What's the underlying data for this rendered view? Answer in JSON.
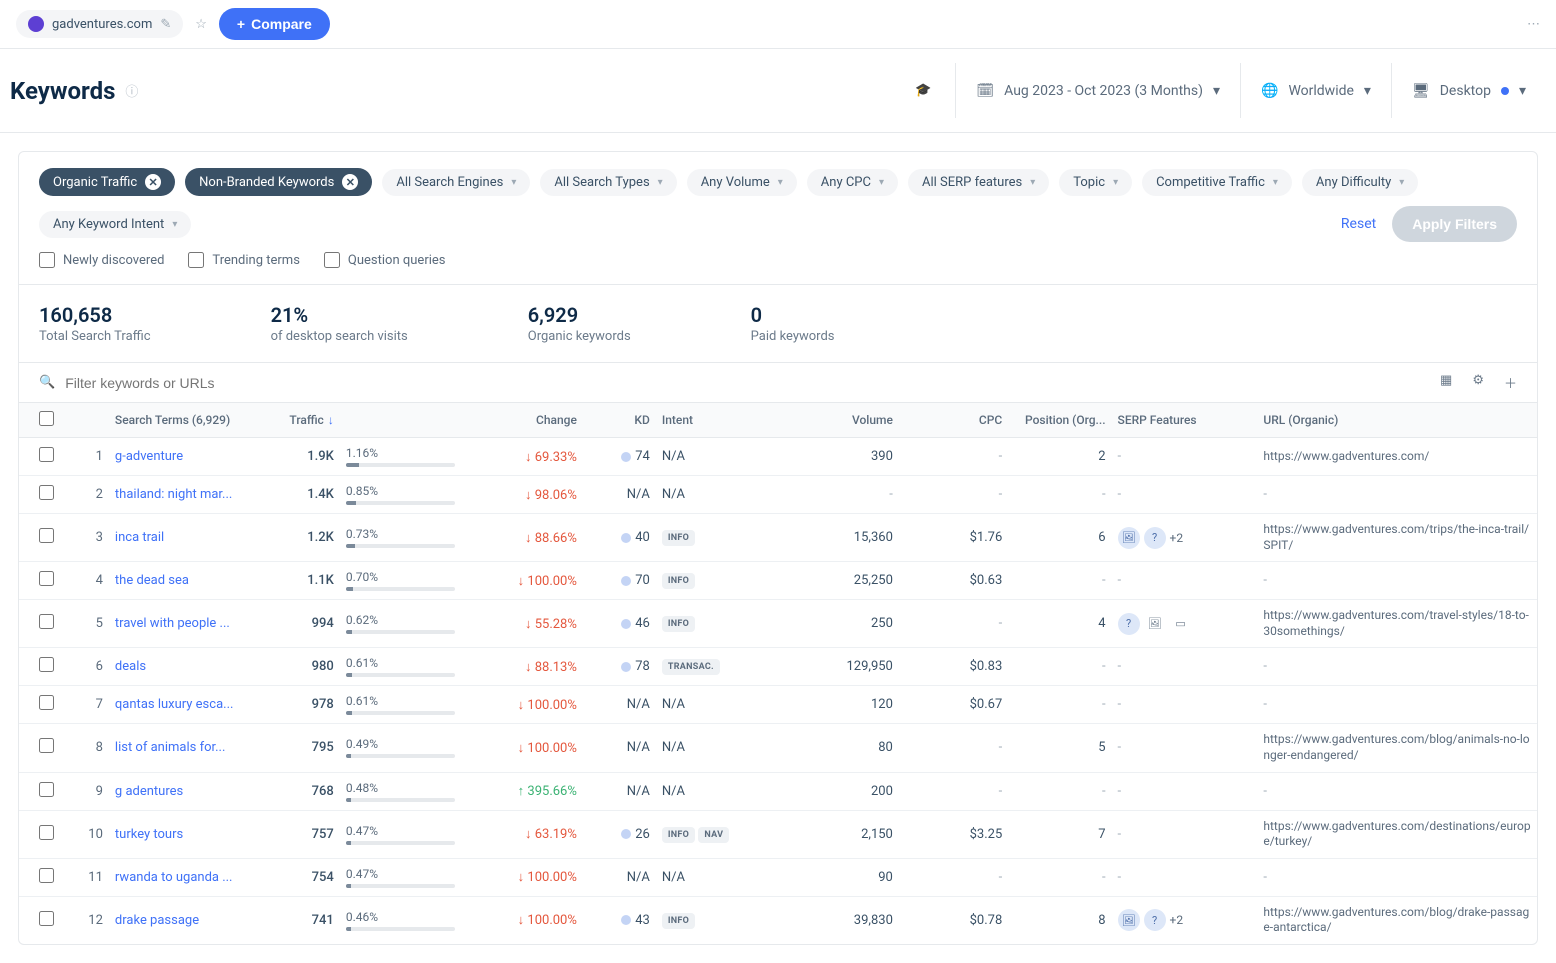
{
  "topbar": {
    "domain": "gadventures.com",
    "compare": "Compare"
  },
  "header": {
    "title": "Keywords",
    "date_filter": "Aug 2023 - Oct 2023 (3 Months)",
    "region": "Worldwide",
    "device": "Desktop"
  },
  "filters": {
    "active": [
      {
        "label": "Organic Traffic"
      },
      {
        "label": "Non-Branded Keywords"
      }
    ],
    "inactive": [
      "All Search Engines",
      "All Search Types",
      "Any Volume",
      "Any CPC",
      "All SERP features",
      "Topic",
      "Competitive Traffic",
      "Any Difficulty",
      "Any Keyword Intent"
    ],
    "checks": [
      "Newly discovered",
      "Trending terms",
      "Question queries"
    ],
    "reset": "Reset",
    "apply": "Apply Filters"
  },
  "stats": [
    {
      "big": "160,658",
      "small": "Total Search Traffic"
    },
    {
      "big": "21%",
      "small": "of desktop search visits"
    },
    {
      "big": "6,929",
      "small": "Organic keywords"
    },
    {
      "big": "0",
      "small": "Paid keywords"
    }
  ],
  "search": {
    "placeholder": "Filter keywords or URLs"
  },
  "table": {
    "headers": {
      "search_terms": "Search Terms (6,929)",
      "traffic": "Traffic",
      "change": "Change",
      "kd": "KD",
      "intent": "Intent",
      "volume": "Volume",
      "cpc": "CPC",
      "position": "Position (Org...",
      "serp": "SERP Features",
      "url": "URL (Organic)"
    },
    "rows": [
      {
        "n": "1",
        "term": "g-adventure",
        "traffic": "1.9K",
        "pct": "1.16%",
        "bar": 12,
        "change": "69.33%",
        "dir": "down",
        "kd": "74",
        "intent": [
          "N/A"
        ],
        "intentNA": true,
        "volume": "390",
        "cpc": "-",
        "pos": "2",
        "serp": "dash",
        "url": "https://www.gadventures.com/"
      },
      {
        "n": "2",
        "term": "thailand: night mar...",
        "traffic": "1.4K",
        "pct": "0.85%",
        "bar": 9,
        "change": "98.06%",
        "dir": "down",
        "kd": "N/A",
        "intent": [
          "N/A"
        ],
        "intentNA": true,
        "volume": "-",
        "cpc": "-",
        "pos": "-",
        "serp": "dash",
        "url": "-"
      },
      {
        "n": "3",
        "term": "inca trail",
        "traffic": "1.2K",
        "pct": "0.73%",
        "bar": 8,
        "change": "88.66%",
        "dir": "down",
        "kd": "40",
        "intent": [
          "INFO"
        ],
        "volume": "15,360",
        "cpc": "$1.76",
        "pos": "6",
        "serp": "img-q-2",
        "url": "https://www.gadventures.com/trips/the-inca-trail/SPIT/"
      },
      {
        "n": "4",
        "term": "the dead sea",
        "traffic": "1.1K",
        "pct": "0.70%",
        "bar": 7,
        "change": "100.00%",
        "dir": "down",
        "kd": "70",
        "intent": [
          "INFO"
        ],
        "volume": "25,250",
        "cpc": "$0.63",
        "pos": "-",
        "serp": "dash",
        "url": "-"
      },
      {
        "n": "5",
        "term": "travel with people ...",
        "traffic": "994",
        "pct": "0.62%",
        "bar": 6,
        "change": "55.28%",
        "dir": "down",
        "kd": "46",
        "intent": [
          "INFO"
        ],
        "volume": "250",
        "cpc": "-",
        "pos": "4",
        "serp": "q-img-plain",
        "url": "https://www.gadventures.com/travel-styles/18-to-30somethings/"
      },
      {
        "n": "6",
        "term": "deals",
        "traffic": "980",
        "pct": "0.61%",
        "bar": 6,
        "change": "88.13%",
        "dir": "down",
        "kd": "78",
        "intent": [
          "TRANSAC."
        ],
        "volume": "129,950",
        "cpc": "$0.83",
        "pos": "-",
        "serp": "dash",
        "url": "-"
      },
      {
        "n": "7",
        "term": "qantas luxury esca...",
        "traffic": "978",
        "pct": "0.61%",
        "bar": 6,
        "change": "100.00%",
        "dir": "down",
        "kd": "N/A",
        "intent": [
          "N/A"
        ],
        "intentNA": true,
        "volume": "120",
        "cpc": "$0.67",
        "pos": "-",
        "serp": "dash",
        "url": "-"
      },
      {
        "n": "8",
        "term": "list of animals for...",
        "traffic": "795",
        "pct": "0.49%",
        "bar": 5,
        "change": "100.00%",
        "dir": "down",
        "kd": "N/A",
        "intent": [
          "N/A"
        ],
        "intentNA": true,
        "volume": "80",
        "cpc": "-",
        "pos": "5",
        "serp": "dash",
        "url": "https://www.gadventures.com/blog/animals-no-longer-endangered/"
      },
      {
        "n": "9",
        "term": "g adentures",
        "traffic": "768",
        "pct": "0.48%",
        "bar": 5,
        "change": "395.66%",
        "dir": "up",
        "kd": "N/A",
        "intent": [
          "N/A"
        ],
        "intentNA": true,
        "volume": "200",
        "cpc": "-",
        "pos": "-",
        "serp": "dash",
        "url": "-"
      },
      {
        "n": "10",
        "term": "turkey tours",
        "traffic": "757",
        "pct": "0.47%",
        "bar": 5,
        "change": "63.19%",
        "dir": "down",
        "kd": "26",
        "intent": [
          "INFO",
          "NAV"
        ],
        "volume": "2,150",
        "cpc": "$3.25",
        "pos": "7",
        "serp": "dash",
        "url": "https://www.gadventures.com/destinations/europe/turkey/"
      },
      {
        "n": "11",
        "term": "rwanda to uganda ...",
        "traffic": "754",
        "pct": "0.47%",
        "bar": 5,
        "change": "100.00%",
        "dir": "down",
        "kd": "N/A",
        "intent": [
          "N/A"
        ],
        "intentNA": true,
        "volume": "90",
        "cpc": "-",
        "pos": "-",
        "serp": "dash",
        "url": "-"
      },
      {
        "n": "12",
        "term": "drake passage",
        "traffic": "741",
        "pct": "0.46%",
        "bar": 5,
        "change": "100.00%",
        "dir": "down",
        "kd": "43",
        "intent": [
          "INFO"
        ],
        "volume": "39,830",
        "cpc": "$0.78",
        "pos": "8",
        "serp": "img-q-2",
        "url": "https://www.gadventures.com/blog/drake-passage-antarctica/"
      }
    ]
  }
}
